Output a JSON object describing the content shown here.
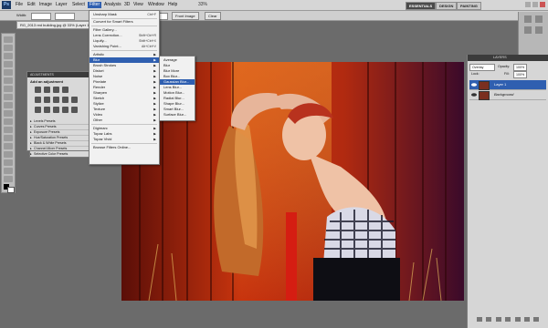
{
  "menubar": {
    "app_icon": "Ps",
    "items": [
      "File",
      "Edit",
      "Image",
      "Layer",
      "Select",
      "Filter",
      "Analysis",
      "3D",
      "View",
      "Window",
      "Help"
    ],
    "zoom_value": "33%",
    "workspaces": [
      "ESSENTIALS",
      "DESIGN",
      "PAINTING"
    ]
  },
  "options": {
    "width_label": "Width:",
    "front_image_label": "Front Image",
    "clear_label": "Clear"
  },
  "document": {
    "tab_title": "RG_2013 red building.jpg @ 33% (Layer 1, RGB/8)"
  },
  "filter_menu": {
    "items": [
      {
        "label": "Unsharp Mask",
        "shortcut": "Ctrl+F"
      },
      {
        "label": "Convert for Smart Filters",
        "shortcut": ""
      },
      {
        "label": "Filter Gallery...",
        "shortcut": ""
      },
      {
        "label": "Lens Correction...",
        "shortcut": "Shift+Ctrl+R"
      },
      {
        "label": "Liquify...",
        "shortcut": "Shift+Ctrl+X"
      },
      {
        "label": "Vanishing Point...",
        "shortcut": "Alt+Ctrl+V"
      },
      {
        "label": "Artistic",
        "shortcut": ""
      },
      {
        "label": "Blur",
        "shortcut": ""
      },
      {
        "label": "Brush Strokes",
        "shortcut": ""
      },
      {
        "label": "Distort",
        "shortcut": ""
      },
      {
        "label": "Noise",
        "shortcut": ""
      },
      {
        "label": "Pixelate",
        "shortcut": ""
      },
      {
        "label": "Render",
        "shortcut": ""
      },
      {
        "label": "Sharpen",
        "shortcut": ""
      },
      {
        "label": "Sketch",
        "shortcut": ""
      },
      {
        "label": "Stylize",
        "shortcut": ""
      },
      {
        "label": "Texture",
        "shortcut": ""
      },
      {
        "label": "Video",
        "shortcut": ""
      },
      {
        "label": "Other",
        "shortcut": ""
      },
      {
        "label": "Digimarc",
        "shortcut": ""
      },
      {
        "label": "Topaz Labs",
        "shortcut": ""
      },
      {
        "label": "Topaz Vivid",
        "shortcut": ""
      },
      {
        "label": "Browse Filters Online...",
        "shortcut": ""
      }
    ]
  },
  "blur_menu": {
    "items": [
      "Average",
      "Blur",
      "Blur More",
      "Box Blur...",
      "Gaussian Blur...",
      "Lens Blur...",
      "Motion Blur...",
      "Radial Blur...",
      "Shape Blur...",
      "Smart Blur...",
      "Surface Blur..."
    ],
    "highlighted": "Gaussian Blur..."
  },
  "adjustments": {
    "tab_label": "ADJUSTMENTS",
    "mask_tab": "MASKS",
    "title": "Add an adjustment",
    "presets": [
      "Levels Presets",
      "Curves Presets",
      "Exposure Presets",
      "Hue/Saturation Presets",
      "Black & White Presets",
      "Channel Mixer Presets",
      "Selective Color Presets"
    ]
  },
  "layers": {
    "tab_label": "LAYERS",
    "blend_mode": "Overlay",
    "opacity_label": "Opacity:",
    "opacity_value": "100%",
    "fill_label": "Fill:",
    "fill_value": "100%",
    "lock_label": "Lock:",
    "rows": [
      {
        "name": "Layer 1",
        "selected": true
      },
      {
        "name": "Background",
        "selected": false
      }
    ]
  },
  "colors": {
    "highlight": "#2f5fb0",
    "menubar": "#d6d6d6",
    "canvas_bg": "#6b6b6b"
  }
}
